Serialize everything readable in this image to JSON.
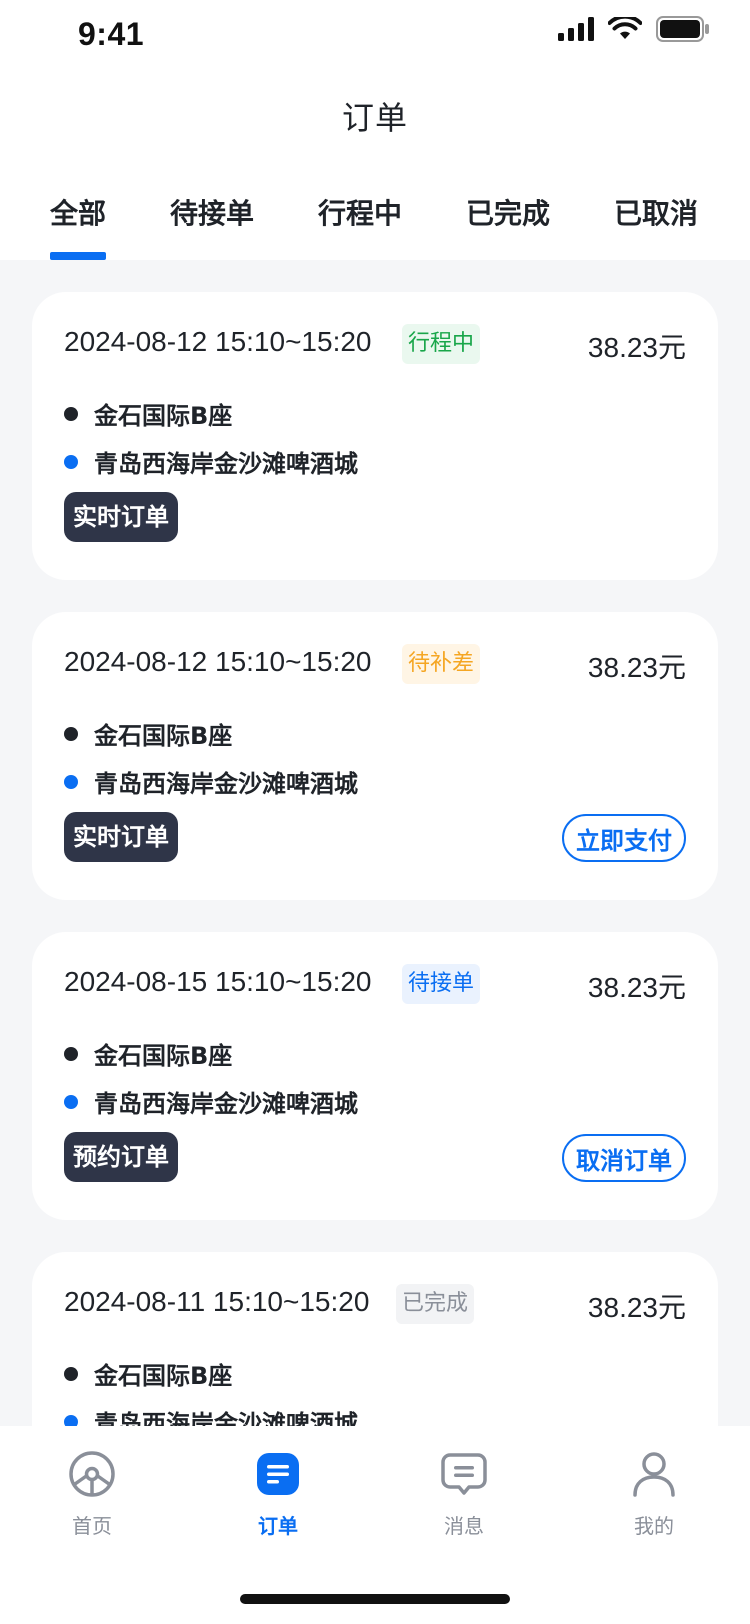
{
  "status_bar": {
    "time": "9:41"
  },
  "header": {
    "title": "订单"
  },
  "tabs": [
    {
      "label": "全部",
      "active": true
    },
    {
      "label": "待接单",
      "active": false
    },
    {
      "label": "行程中",
      "active": false
    },
    {
      "label": "已完成",
      "active": false
    },
    {
      "label": "已取消",
      "active": false
    }
  ],
  "orders": [
    {
      "time": "2024-08-12 15:10~15:20",
      "status": "行程中",
      "status_color": "#19a64a",
      "price": "38.23元",
      "from": "金石国际B座",
      "to": "青岛西海岸金沙滩啤酒城",
      "type": "实时订单",
      "action": ""
    },
    {
      "time": "2024-08-12 15:10~15:20",
      "status": "待补差",
      "status_color": "#f5a623",
      "price": "38.23元",
      "from": "金石国际B座",
      "to": "青岛西海岸金沙滩啤酒城",
      "type": "实时订单",
      "action": "立即支付"
    },
    {
      "time": "2024-08-15 15:10~15:20",
      "status": "待接单",
      "status_color": "#0a6ef2",
      "price": "38.23元",
      "from": "金石国际B座",
      "to": "青岛西海岸金沙滩啤酒城",
      "type": "预约订单",
      "action": "取消订单"
    },
    {
      "time": "2024-08-11 15:10~15:20",
      "status": "已完成",
      "status_color": "#8a8f99",
      "price": "38.23元",
      "from": "金石国际B座",
      "to": "青岛西海岸金沙滩啤酒城",
      "type": "",
      "action": ""
    }
  ],
  "bottom_nav": [
    {
      "label": "首页",
      "icon": "steering-wheel-icon",
      "active": false
    },
    {
      "label": "订单",
      "icon": "order-list-icon",
      "active": true
    },
    {
      "label": "消息",
      "icon": "message-icon",
      "active": false
    },
    {
      "label": "我的",
      "icon": "profile-icon",
      "active": false
    }
  ],
  "colors": {
    "accent": "#0a6ef2",
    "tag_bg": "#2f3548",
    "background": "#f5f6f8"
  }
}
